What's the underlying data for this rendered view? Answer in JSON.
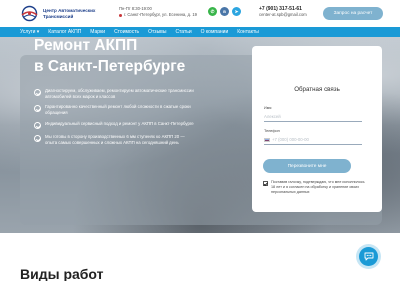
{
  "header": {
    "logo_text": "Центр Автоматических Трансмиссий",
    "hours": "Пн-Пт 8:30-19:00",
    "address": "г. Санкт-Петербург, ул. Есенина, д. 19",
    "phone": "+7 (901) 317-51-61",
    "email": "center-at.spb@gmail.com",
    "request_button": "Запрос на расчет",
    "social_icons": [
      "whatsapp-icon",
      "vk-icon",
      "telegram-icon"
    ]
  },
  "nav": {
    "items": [
      "Услуги ▾",
      "Каталог АКПП",
      "Марки",
      "Стоимость",
      "Отзывы",
      "Статьи",
      "О компании",
      "Контакты"
    ]
  },
  "hero": {
    "title_line1": "Ремонт АКПП",
    "title_line2": "в Санкт-Петербурге",
    "features": [
      "Диагностируем, обслуживаем, ремонтируем автоматические трансмиссии автомобилей всех марок и классов",
      "Гарантированно качественный ремонт любой сложности в сжатые сроки обращения",
      "Индивидуальный сервисный подход и ремонт у АКПП в Санкт-Петербурге",
      "Мы готовы в сторону производственных 6 мм ступенях ко АКПП 20 — опыта самых совершенных и сложных АКПП на сегодняшний день"
    ]
  },
  "form": {
    "title": "Обратная связь",
    "name_label": "Имя",
    "name_placeholder": "Алексей",
    "phone_label": "Телефон",
    "phone_placeholder": "+7 (000) 000-00-00",
    "submit_label": "Перезвоните мне",
    "consent_text": "Поставив галочку, подтверждаю, что мне исполнилось 18 лет и я согласен на обработку и хранение своих персональных данных"
  },
  "section": {
    "title": "Виды работ"
  },
  "colors": {
    "accent": "#1a9ad6",
    "button": "#7fb2cf",
    "brand": "#1d3f8a"
  }
}
